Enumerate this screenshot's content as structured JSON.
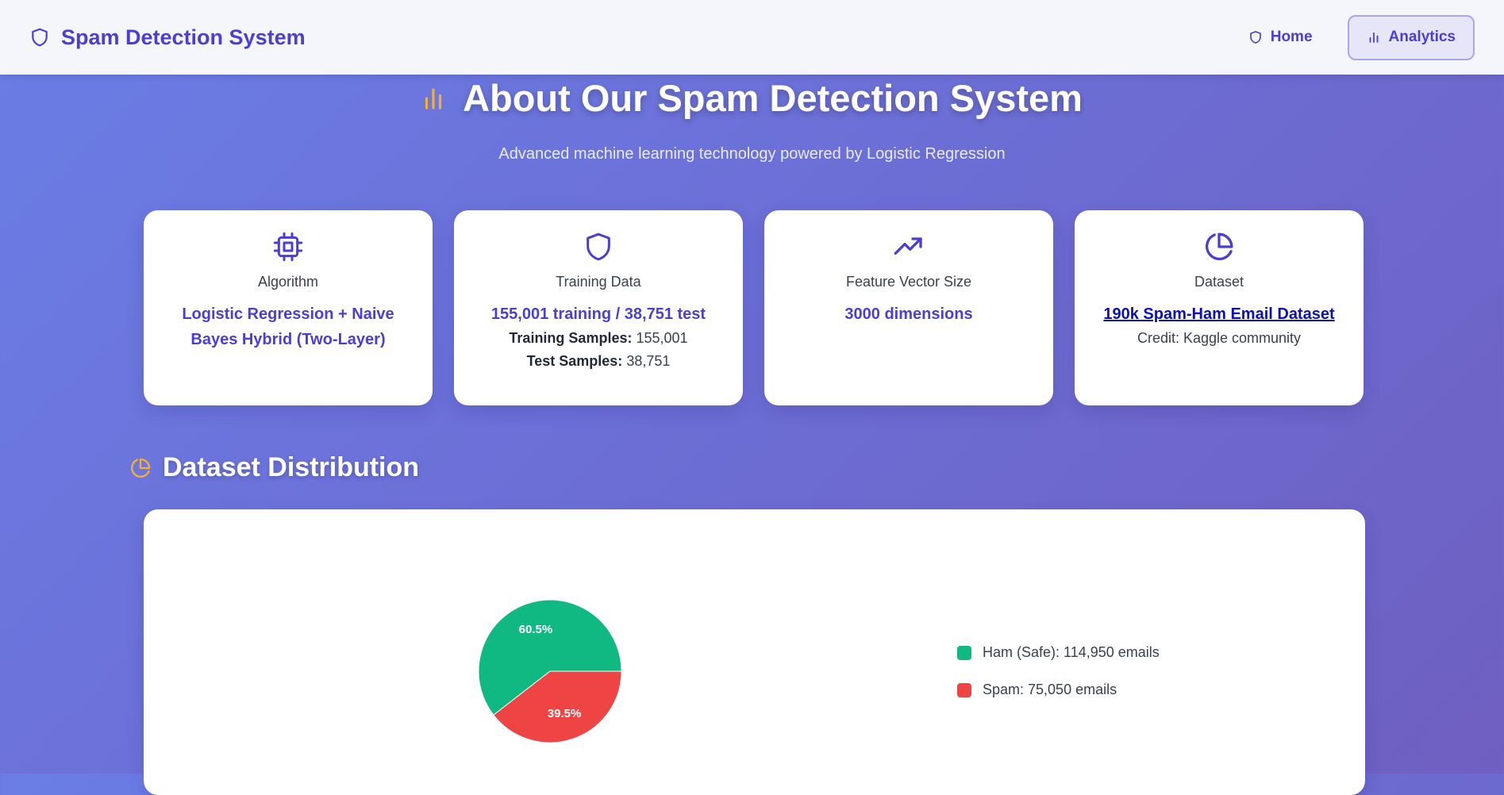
{
  "navbar": {
    "brand": "Spam Detection System",
    "links": [
      {
        "label": "Home",
        "icon": "shield-icon",
        "active": false
      },
      {
        "label": "Analytics",
        "icon": "bar-chart-icon",
        "active": true
      }
    ]
  },
  "hero": {
    "title": "About Our Spam Detection System",
    "subtitle": "Advanced machine learning technology powered by Logistic Regression"
  },
  "cards": {
    "algorithm": {
      "label": "Algorithm",
      "value": "Logistic Regression + Naive Bayes Hybrid (Two-Layer)",
      "icon": "cpu-icon"
    },
    "training": {
      "label": "Training Data",
      "value": "155,001 training / 38,751 test",
      "train_key": "Training Samples:",
      "train_val": "155,001",
      "test_key": "Test Samples:",
      "test_val": "38,751",
      "icon": "shield-icon"
    },
    "feature": {
      "label": "Feature Vector Size",
      "value": "3000 dimensions",
      "icon": "trending-up-icon"
    },
    "dataset": {
      "label": "Dataset",
      "value": "190k Spam-Ham Email Dataset",
      "credit": "Credit: Kaggle community",
      "icon": "pie-chart-icon"
    }
  },
  "distribution": {
    "title": "Dataset Distribution",
    "legend": [
      {
        "label": "Ham (Safe): 114,950 emails",
        "color": "#10b981"
      },
      {
        "label": "Spam: 75,050 emails",
        "color": "#ef4444"
      }
    ]
  },
  "chart_data": {
    "type": "pie",
    "categories": [
      "Ham (Safe)",
      "Spam"
    ],
    "values": [
      114950,
      75050
    ],
    "percent_labels": [
      "60.5%",
      "39.5%"
    ],
    "colors": [
      "#10b981",
      "#ef4444"
    ]
  },
  "colors": {
    "accent": "#4a3fd2",
    "icon_accent": "#f2b035"
  }
}
